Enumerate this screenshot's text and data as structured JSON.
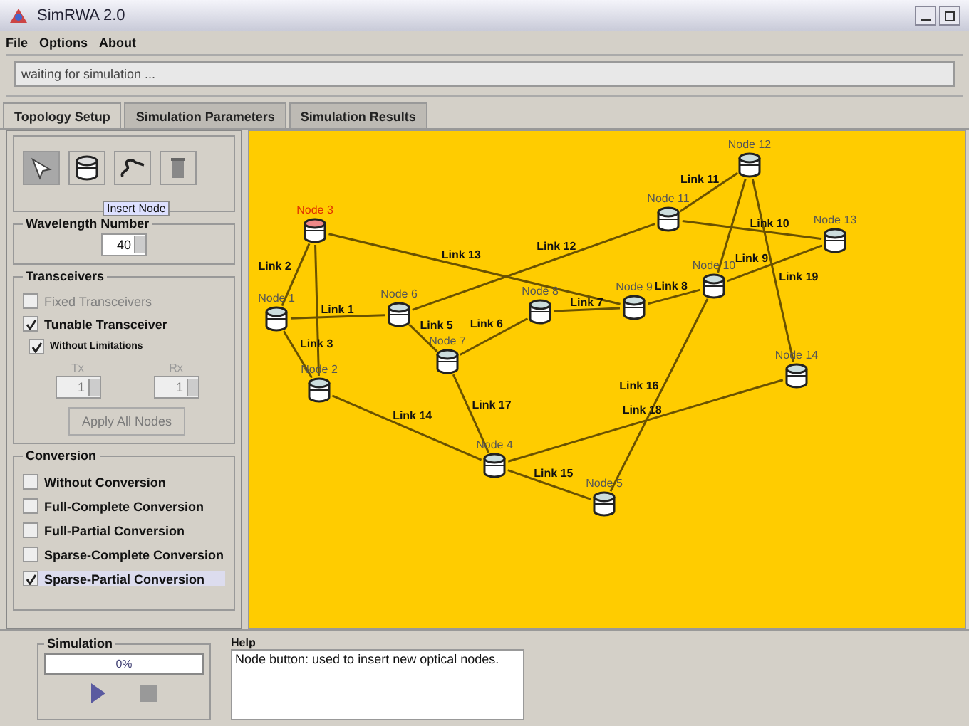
{
  "window": {
    "title": "SimRWA 2.0"
  },
  "menu": [
    "File",
    "Options",
    "About"
  ],
  "status": "waiting for simulation ...",
  "tabs": [
    {
      "label": "Topology Setup",
      "selected": true
    },
    {
      "label": "Simulation Parameters",
      "selected": false
    },
    {
      "label": "Simulation Results",
      "selected": false
    }
  ],
  "tools": [
    {
      "kind": "select",
      "selected": true
    },
    {
      "kind": "node",
      "selected": false
    },
    {
      "kind": "link",
      "selected": false
    },
    {
      "kind": "delete",
      "selected": false
    }
  ],
  "tooltip": "Insert Node",
  "wavelength": {
    "title": "Wavelength Number",
    "value": "40"
  },
  "transceivers": {
    "title": "Transceivers",
    "options": [
      {
        "label": "Fixed Transceivers",
        "checked": false,
        "disabled": true
      },
      {
        "label": "Tunable Transceiver",
        "checked": true,
        "disabled": false
      }
    ],
    "limitations": {
      "label": "Without Limitations",
      "checked": true
    },
    "tx": {
      "label": "Tx",
      "value": "1"
    },
    "rx": {
      "label": "Rx",
      "value": "1"
    },
    "apply_button": {
      "label": "Apply All Nodes",
      "disabled": true
    }
  },
  "conversion": {
    "title": "Conversion",
    "options": [
      {
        "label": "Without Conversion",
        "checked": false
      },
      {
        "label": "Full-Complete Conversion",
        "checked": false
      },
      {
        "label": "Full-Partial Conversion",
        "checked": false
      },
      {
        "label": "Sparse-Complete Conversion",
        "checked": false
      },
      {
        "label": "Sparse-Partial Conversion",
        "checked": true
      }
    ]
  },
  "topology": {
    "nodes": [
      {
        "label": "Node 1",
        "selected": false
      },
      {
        "label": "Node 2",
        "selected": false
      },
      {
        "label": "Node 3",
        "selected": true
      },
      {
        "label": "Node 4",
        "selected": false
      },
      {
        "label": "Node 5",
        "selected": false
      },
      {
        "label": "Node 6",
        "selected": false
      },
      {
        "label": "Node 7",
        "selected": false
      },
      {
        "label": "Node 8",
        "selected": false
      },
      {
        "label": "Node 9",
        "selected": false
      },
      {
        "label": "Node 10",
        "selected": false
      },
      {
        "label": "Node 11",
        "selected": false
      },
      {
        "label": "Node 12",
        "selected": false
      },
      {
        "label": "Node 13",
        "selected": false
      },
      {
        "label": "Node 14",
        "selected": false
      }
    ],
    "links": [
      {
        "label": "Link 1"
      },
      {
        "label": "Link 2"
      },
      {
        "label": "Link 3"
      },
      {
        "label": "Link 5"
      },
      {
        "label": "Link 6"
      },
      {
        "label": "Link 7"
      },
      {
        "label": "Link 8"
      },
      {
        "label": "Link 9"
      },
      {
        "label": "Link 10"
      },
      {
        "label": "Link 11"
      },
      {
        "label": "Link 12"
      },
      {
        "label": "Link 13"
      },
      {
        "label": "Link 14"
      },
      {
        "label": "Link 15"
      },
      {
        "label": "Link 16"
      },
      {
        "label": "Link 17"
      },
      {
        "label": "Link 18"
      },
      {
        "label": "Link 19"
      }
    ]
  },
  "simulation": {
    "title": "Simulation",
    "progress_text": "0%",
    "level": 0
  },
  "help": {
    "title": "Help",
    "text": "Node button: used to insert new optical nodes."
  }
}
